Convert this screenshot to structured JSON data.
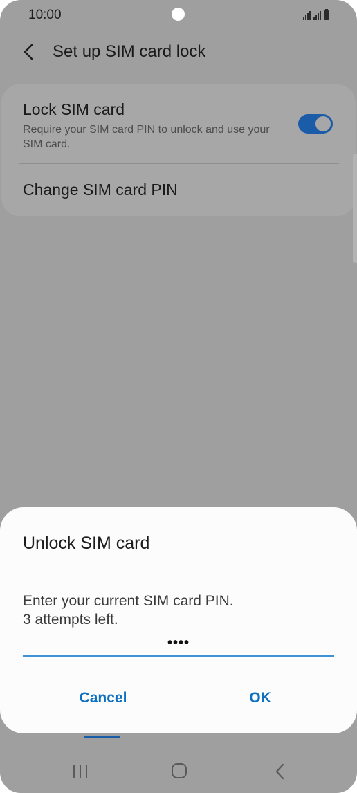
{
  "status_bar": {
    "time": "10:00"
  },
  "app_bar": {
    "title": "Set up SIM card lock",
    "back_icon": "chevron-left-icon"
  },
  "settings": {
    "lock_sim": {
      "title": "Lock SIM card",
      "description": "Require your SIM card PIN to unlock and use your SIM card.",
      "enabled": true
    },
    "change_pin": {
      "title": "Change SIM card PIN"
    }
  },
  "dialog": {
    "title": "Unlock SIM card",
    "message_line1": "Enter your current SIM card PIN.",
    "message_line2": "3 attempts left.",
    "pin_value": "••••",
    "cancel_label": "Cancel",
    "ok_label": "OK"
  },
  "nav_bar": {
    "recents_icon": "recents-icon",
    "home_icon": "home-icon",
    "back_icon": "back-icon"
  },
  "colors": {
    "accent": "#0d6fc0",
    "toggle_on": "#1b5ca8",
    "input_underline": "#3e91d4",
    "scrim_background": "#9f9f9f",
    "dialog_background": "#fcfcfc"
  }
}
